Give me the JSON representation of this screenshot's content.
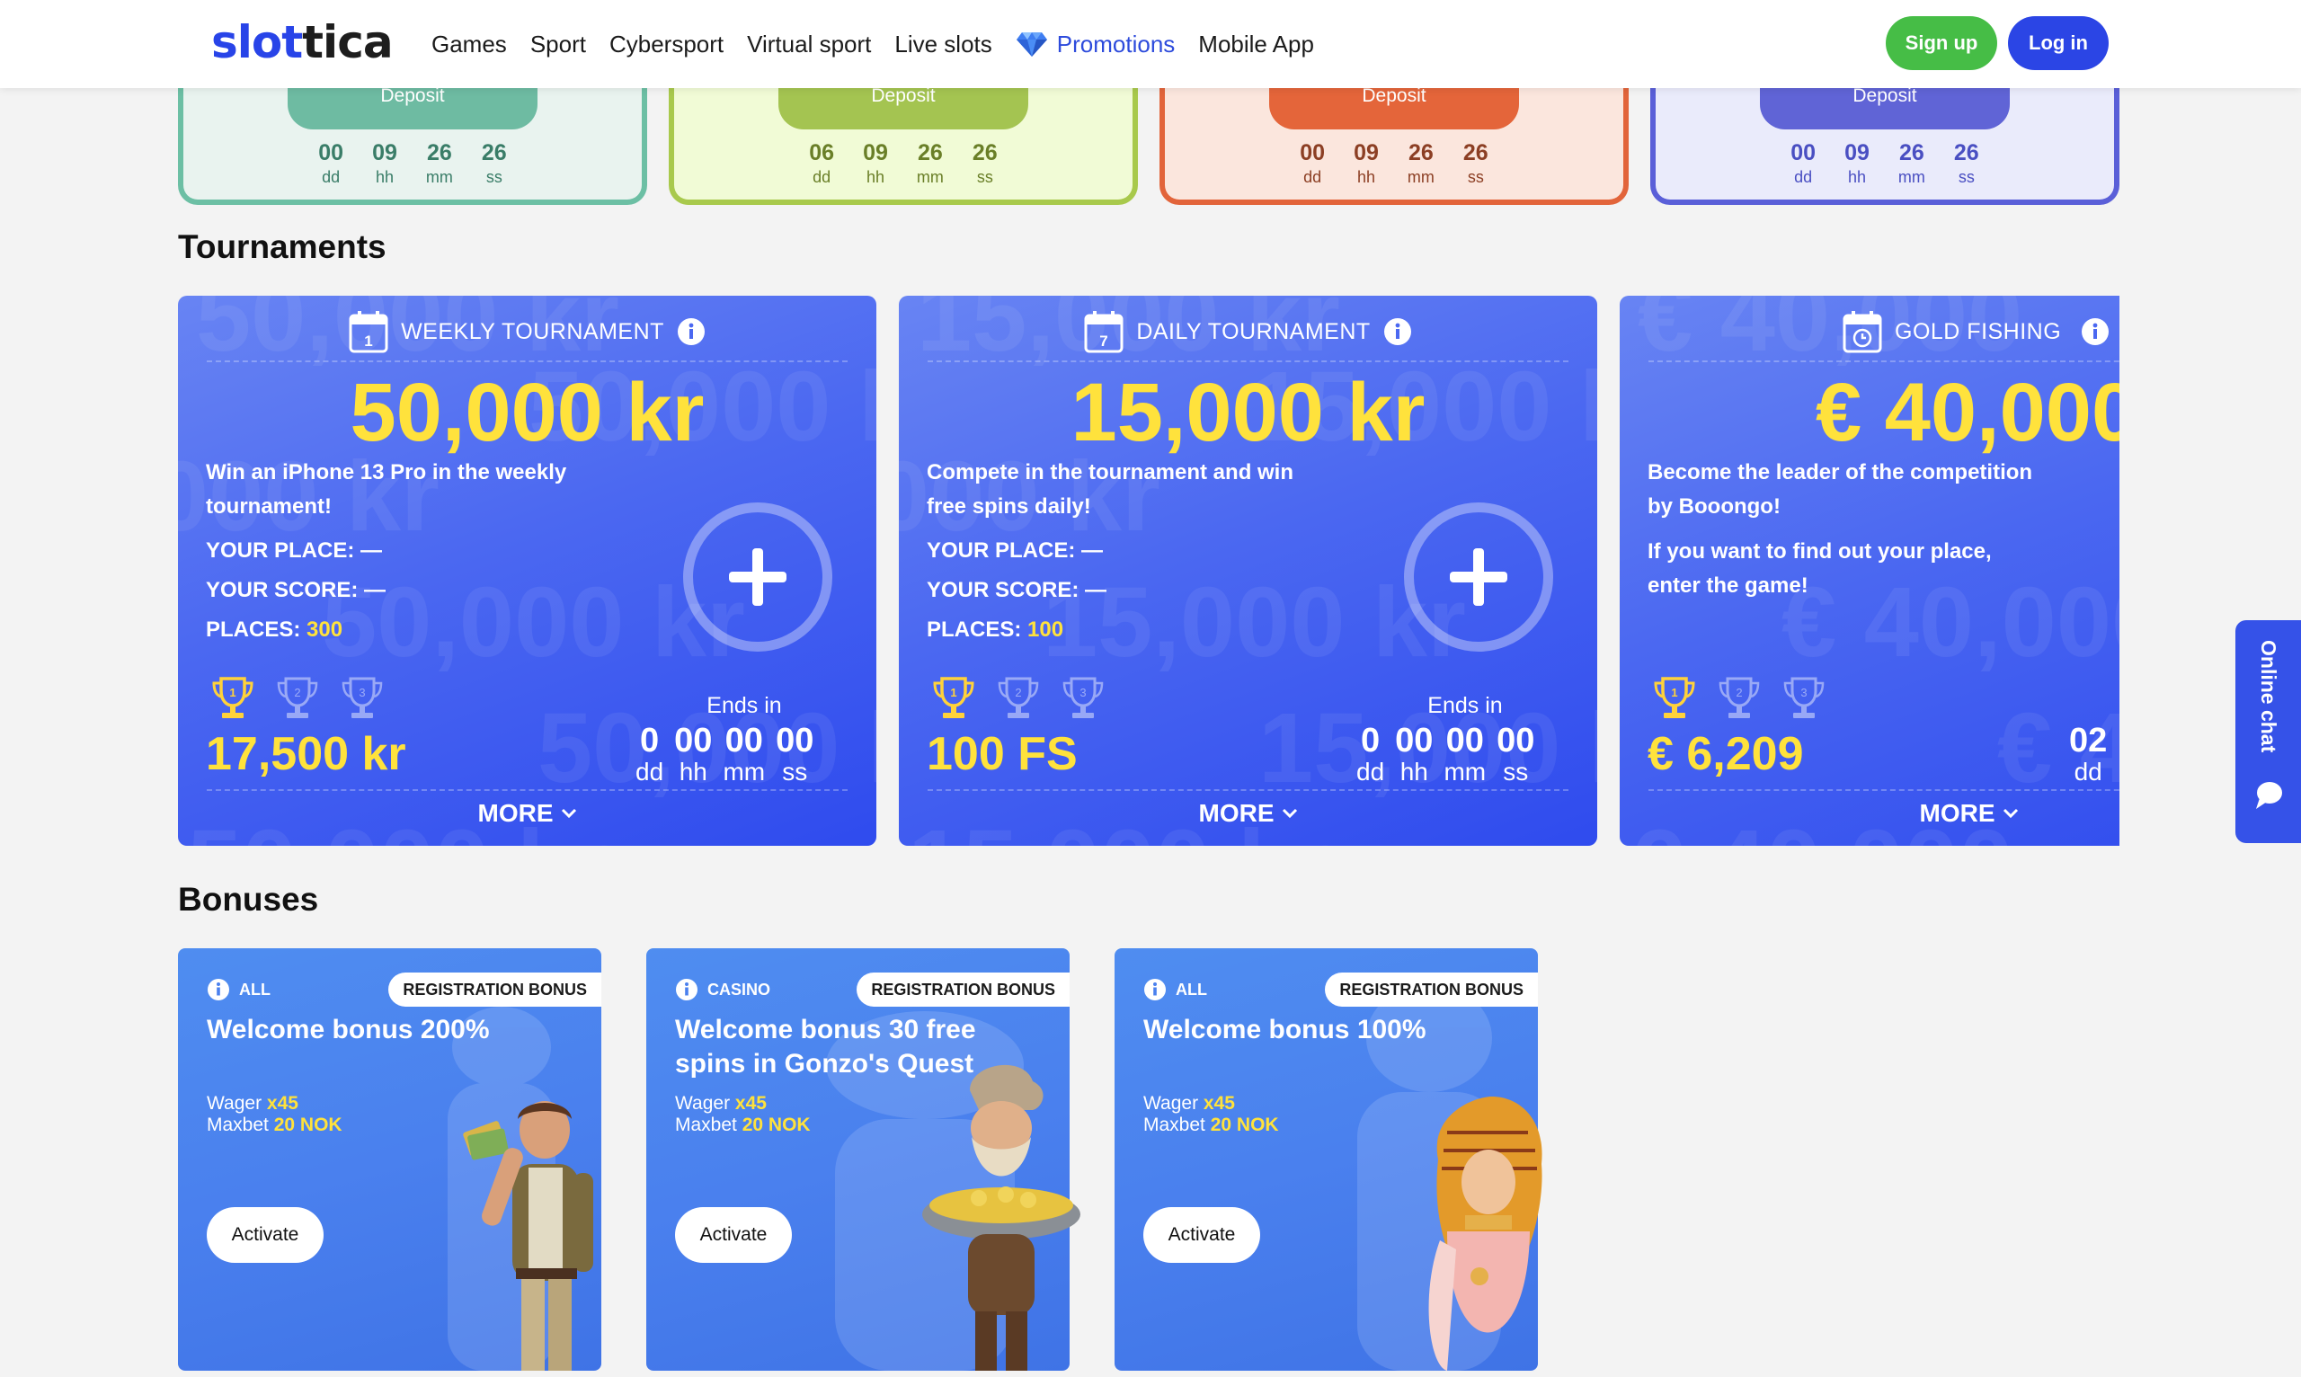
{
  "header": {
    "logo_part1": "slot",
    "logo_part2": "tica",
    "nav": [
      "Games",
      "Sport",
      "Cybersport",
      "Virtual sport",
      "Live slots",
      "Promotions",
      "Mobile App"
    ],
    "signup": "Sign up",
    "login": "Log in"
  },
  "deposit_cards": [
    {
      "button": "Deposit",
      "timer": [
        "00",
        "09",
        "26",
        "26"
      ],
      "units": [
        "dd",
        "hh",
        "mm",
        "ss"
      ],
      "bg": "#e9f3ef",
      "border": "#6cbfa4",
      "btn": "#6ebba2",
      "text": "#3a7d68"
    },
    {
      "button": "Deposit",
      "timer": [
        "06",
        "09",
        "26",
        "26"
      ],
      "units": [
        "dd",
        "hh",
        "mm",
        "ss"
      ],
      "bg": "#f1fbd6",
      "border": "#a8c94c",
      "btn": "#a4c451",
      "text": "#6a7f28"
    },
    {
      "button": "Deposit",
      "timer": [
        "00",
        "09",
        "26",
        "26"
      ],
      "units": [
        "dd",
        "hh",
        "mm",
        "ss"
      ],
      "bg": "#fbe6dd",
      "border": "#e2643a",
      "btn": "#e4653a",
      "text": "#8c3f24"
    },
    {
      "button": "Deposit",
      "timer": [
        "00",
        "09",
        "26",
        "26"
      ],
      "units": [
        "dd",
        "hh",
        "mm",
        "ss"
      ],
      "bg": "#eaebfb",
      "border": "#5a5fd8",
      "btn": "#6064d6",
      "text": "#4a4fc2"
    }
  ],
  "sections": {
    "tournaments": "Tournaments",
    "bonuses": "Bonuses"
  },
  "tournaments": [
    {
      "title": "WEEKLY TOURNAMENT",
      "calendar_day": "1",
      "prize": "50,000 kr",
      "description": "Win an iPhone 13 Pro in the weekly tournament!",
      "place_label": "YOUR PLACE:",
      "place_value": "—",
      "score_label": "YOUR SCORE:",
      "score_value": "—",
      "places_label": "PLACES:",
      "places_value": "300",
      "value": "17,500 kr",
      "ends_in": "Ends in",
      "timer": [
        "0",
        "00",
        "00",
        "00"
      ],
      "units": [
        "dd",
        "hh",
        "mm",
        "ss"
      ],
      "more": "MORE"
    },
    {
      "title": "DAILY TOURNAMENT",
      "calendar_day": "7",
      "prize": "15,000 kr",
      "description": "Compete in the tournament and win free spins daily!",
      "place_label": "YOUR PLACE:",
      "place_value": "—",
      "score_label": "YOUR SCORE:",
      "score_value": "—",
      "places_label": "PLACES:",
      "places_value": "100",
      "value": "100 FS",
      "ends_in": "Ends in",
      "timer": [
        "0",
        "00",
        "00",
        "00"
      ],
      "units": [
        "dd",
        "hh",
        "mm",
        "ss"
      ],
      "more": "MORE"
    },
    {
      "title": "GOLD FISHING",
      "prize": "€ 40,000",
      "description": "Become the leader of the competition by Booongo!",
      "description2": "If you want to find out your place, enter the game!",
      "value": "€ 6,209",
      "timer_days": "02",
      "timer_days_unit": "dd",
      "more": "MORE"
    }
  ],
  "bonuses": [
    {
      "category": "ALL",
      "badge": "REGISTRATION BONUS",
      "title": "Welcome bonus 200%",
      "wager_label": "Wager",
      "wager": "x45",
      "maxbet_label": "Maxbet",
      "maxbet": "20 NOK",
      "activate": "Activate"
    },
    {
      "category": "CASINO",
      "badge": "REGISTRATION BONUS",
      "title": "Welcome bonus 30 free spins in Gonzo's Quest",
      "wager_label": "Wager",
      "wager": "x45",
      "maxbet_label": "Maxbet",
      "maxbet": "20 NOK",
      "activate": "Activate"
    },
    {
      "category": "ALL",
      "badge": "REGISTRATION BONUS",
      "title": "Welcome bonus 100%",
      "wager_label": "Wager",
      "wager": "x45",
      "maxbet_label": "Maxbet",
      "maxbet": "20 NOK",
      "activate": "Activate"
    }
  ],
  "chat": {
    "label": "Online chat"
  },
  "icons": {
    "promo": "diamond-icon",
    "info": "info-icon",
    "calendar": "calendar-icon",
    "plus": "plus-icon",
    "trophy": "trophy-icon",
    "chevron": "chevron-down-icon",
    "chat": "chat-bubble-icon"
  },
  "colors": {
    "brand_blue": "#2b45e5",
    "signup_green": "#46bd46",
    "prize_yellow": "#ffe23c"
  }
}
